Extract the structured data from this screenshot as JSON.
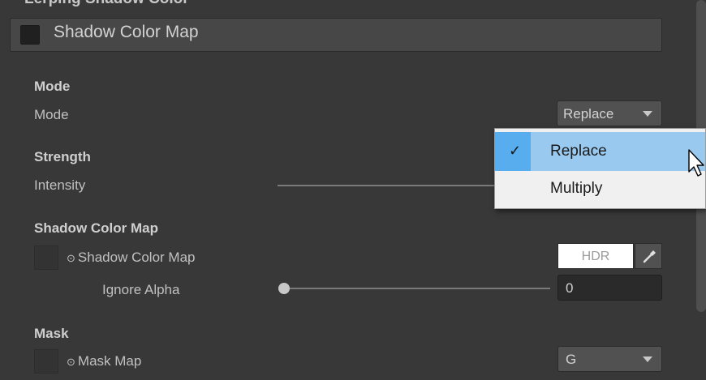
{
  "panel": {
    "top_cut_title": "Lerping Shadow Color",
    "header": {
      "title": "Shadow Color Map",
      "enabled": false
    }
  },
  "sections": {
    "mode": {
      "heading": "Mode",
      "label": "Mode",
      "value": "Replace",
      "options": [
        "Replace",
        "Multiply"
      ],
      "selected_option": "Replace"
    },
    "strength": {
      "heading": "Strength",
      "label": "Intensity"
    },
    "shadow_color_map": {
      "heading": "Shadow Color Map",
      "label": "Shadow Color Map",
      "color_field_text": "HDR",
      "ignore_alpha_label": "Ignore Alpha",
      "ignore_alpha_value": "0"
    },
    "mask": {
      "heading": "Mask",
      "label": "Mask Map",
      "channel": "G"
    }
  },
  "icons": {
    "dropdown_caret": "chevron-down-icon",
    "check": "checkmark-icon",
    "texture": "texture-slot-icon",
    "eyedropper": "eyedropper-icon",
    "cursor": "mouse-cursor-icon"
  },
  "colors": {
    "background": "#383838",
    "selected_highlight": "#99c9ef",
    "check_column": "#58adee",
    "popup_background": "#f0f0f0"
  }
}
